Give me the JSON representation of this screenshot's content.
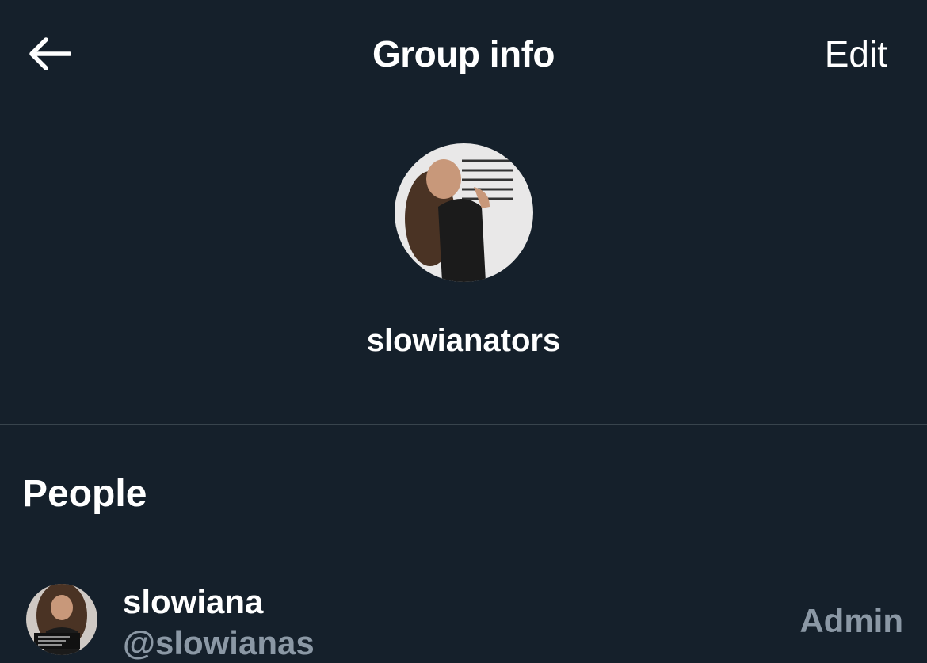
{
  "header": {
    "title": "Group info",
    "edit_label": "Edit",
    "back_icon": "arrow-left-icon"
  },
  "group": {
    "name": "slowianators",
    "avatar": "group-avatar-photo"
  },
  "people": {
    "section_title": "People",
    "members": [
      {
        "name": "slowiana",
        "handle": "@slowianas",
        "role": "Admin",
        "avatar": "member-avatar-photo"
      }
    ]
  },
  "colors": {
    "background": "#15202b",
    "divider": "#38444d",
    "text_primary": "#ffffff",
    "text_secondary": "#8b98a5"
  }
}
